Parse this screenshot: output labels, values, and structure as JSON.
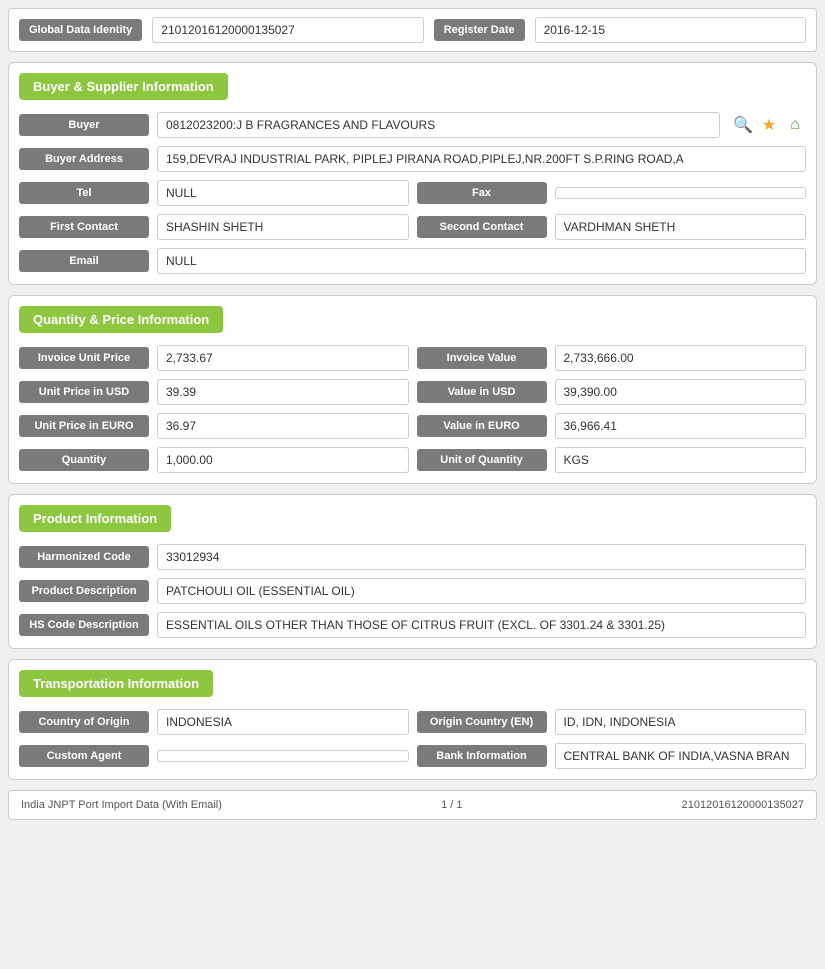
{
  "top": {
    "global_data_identity_label": "Global Data Identity",
    "global_data_identity_value": "21012016120000135027",
    "register_date_label": "Register Date",
    "register_date_value": "2016-12-15"
  },
  "buyer_supplier": {
    "section_title": "Buyer & Supplier Information",
    "buyer_label": "Buyer",
    "buyer_value": "0812023200:J B FRAGRANCES AND FLAVOURS",
    "buyer_address_label": "Buyer Address",
    "buyer_address_value": "159,DEVRAJ INDUSTRIAL PARK, PIPLEJ PIRANA ROAD,PIPLEJ,NR.200FT S.P.RING ROAD,A",
    "tel_label": "Tel",
    "tel_value": "NULL",
    "fax_label": "Fax",
    "fax_value": "",
    "first_contact_label": "First Contact",
    "first_contact_value": "SHASHIN SHETH",
    "second_contact_label": "Second Contact",
    "second_contact_value": "VARDHMAN SHETH",
    "email_label": "Email",
    "email_value": "NULL"
  },
  "quantity_price": {
    "section_title": "Quantity & Price Information",
    "invoice_unit_price_label": "Invoice Unit Price",
    "invoice_unit_price_value": "2,733.67",
    "invoice_value_label": "Invoice Value",
    "invoice_value_value": "2,733,666.00",
    "unit_price_usd_label": "Unit Price in USD",
    "unit_price_usd_value": "39.39",
    "value_usd_label": "Value in USD",
    "value_usd_value": "39,390.00",
    "unit_price_euro_label": "Unit Price in EURO",
    "unit_price_euro_value": "36.97",
    "value_euro_label": "Value in EURO",
    "value_euro_value": "36,966.41",
    "quantity_label": "Quantity",
    "quantity_value": "1,000.00",
    "unit_of_quantity_label": "Unit of Quantity",
    "unit_of_quantity_value": "KGS"
  },
  "product": {
    "section_title": "Product Information",
    "harmonized_code_label": "Harmonized Code",
    "harmonized_code_value": "33012934",
    "product_description_label": "Product Description",
    "product_description_value": "PATCHOULI OIL (ESSENTIAL OIL)",
    "hs_code_description_label": "HS Code Description",
    "hs_code_description_value": "ESSENTIAL OILS OTHER THAN THOSE OF CITRUS FRUIT (EXCL. OF 3301.24 & 3301.25)"
  },
  "transportation": {
    "section_title": "Transportation Information",
    "country_of_origin_label": "Country of Origin",
    "country_of_origin_value": "INDONESIA",
    "origin_country_en_label": "Origin Country (EN)",
    "origin_country_en_value": "ID, IDN, INDONESIA",
    "custom_agent_label": "Custom Agent",
    "custom_agent_value": "",
    "bank_information_label": "Bank Information",
    "bank_information_value": "CENTRAL BANK OF INDIA,VASNA BRAN"
  },
  "footer": {
    "left": "India JNPT Port Import Data (With Email)",
    "center": "1 / 1",
    "right": "21012016120000135027"
  }
}
